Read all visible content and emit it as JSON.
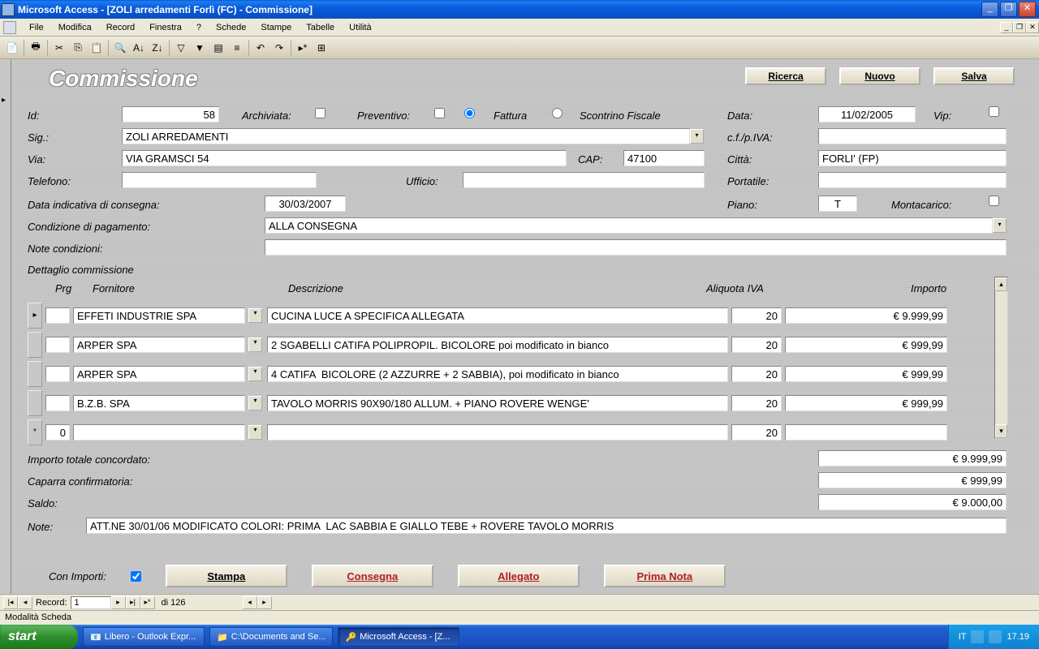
{
  "titlebar": {
    "title": "Microsoft Access - [ZOLI arredamenti Forlì (FC) - Commissione]"
  },
  "menu": [
    "File",
    "Modifica",
    "Record",
    "Finestra",
    "?",
    "Schede",
    "Stampe",
    "Tabelle",
    "Utilità"
  ],
  "form": {
    "title": "Commissione",
    "buttons": {
      "ricerca": "Ricerca",
      "nuovo": "Nuovo",
      "salva": "Salva"
    },
    "labels": {
      "id": "Id:",
      "archiviata": "Archiviata:",
      "preventivo": "Preventivo:",
      "fattura": "Fattura",
      "scontrino": "Scontrino Fiscale",
      "data": "Data:",
      "vip": "Vip:",
      "sig": "Sig.:",
      "cfpiva": "c.f./p.IVA:",
      "via": "Via:",
      "cap": "CAP:",
      "citta": "Città:",
      "telefono": "Telefono:",
      "ufficio": "Ufficio:",
      "portatile": "Portatile:",
      "data_consegna": "Data indicativa di consegna:",
      "piano": "Piano:",
      "montacarico": "Montacarico:",
      "cond_pagamento": "Condizione di pagamento:",
      "note_cond": "Note condizioni:",
      "dettaglio": "Dettaglio commissione",
      "importo_totale": "Importo totale concordato:",
      "caparra": "Caparra confirmatoria:",
      "saldo": "Saldo:",
      "note": "Note:",
      "con_importi": "Con Importi:"
    },
    "values": {
      "id": "58",
      "data": "11/02/2005",
      "sig": "ZOLI ARREDAMENTI",
      "cfpiva": "",
      "via": "VIA GRAMSCI 54",
      "cap": "47100",
      "citta": "FORLI' (FP)",
      "telefono": "",
      "ufficio": "",
      "portatile": "",
      "data_consegna": "30/03/2007",
      "piano": "T",
      "cond_pagamento": "ALLA CONSEGNA",
      "note_cond": "",
      "importo_totale": "€ 9.999,99",
      "caparra": "€ 999,99",
      "saldo": "€ 9.000,00",
      "note": "ATT.NE 30/01/06 MODIFICATO COLORI: PRIMA  LAC SABBIA E GIALLO TEBE + ROVERE TAVOLO MORRIS"
    },
    "grid": {
      "headers": {
        "prg": "Prg",
        "fornitore": "Fornitore",
        "descrizione": "Descrizione",
        "aliquota": "Aliquota IVA",
        "importo": "Importo"
      },
      "rows": [
        {
          "prg": "",
          "fornitore": "EFFETI INDUSTRIE SPA",
          "descrizione": "CUCINA LUCE A SPECIFICA ALLEGATA",
          "aliquota": "20",
          "importo": "€ 9.999,99"
        },
        {
          "prg": "",
          "fornitore": "ARPER SPA",
          "descrizione": "2 SGABELLI CATIFA POLIPROPIL. BICOLORE poi modificato in bianco",
          "aliquota": "20",
          "importo": "€ 999,99"
        },
        {
          "prg": "",
          "fornitore": "ARPER SPA",
          "descrizione": "4 CATIFA  BICOLORE (2 AZZURRE + 2 SABBIA), poi modificato in bianco",
          "aliquota": "20",
          "importo": "€ 999,99"
        },
        {
          "prg": "",
          "fornitore": "B.Z.B. SPA",
          "descrizione": "TAVOLO MORRIS 90X90/180 ALLUM. + PIANO ROVERE WENGE'",
          "aliquota": "20",
          "importo": "€ 999,99"
        },
        {
          "prg": "0",
          "fornitore": "",
          "descrizione": "",
          "aliquota": "20",
          "importo": ""
        }
      ]
    },
    "footer_buttons": {
      "stampa": "Stampa",
      "consegna": "Consegna",
      "allegato": "Allegato",
      "prima_nota": "Prima Nota"
    }
  },
  "nav": {
    "record_label": "Record:",
    "current": "1",
    "total": "di 126"
  },
  "status": "Modalità Scheda",
  "taskbar": {
    "start": "start",
    "tasks": [
      "Libero - Outlook Expr...",
      "C:\\Documents and Se...",
      "Microsoft Access - [Z..."
    ],
    "lang": "IT",
    "time": "17.19"
  }
}
